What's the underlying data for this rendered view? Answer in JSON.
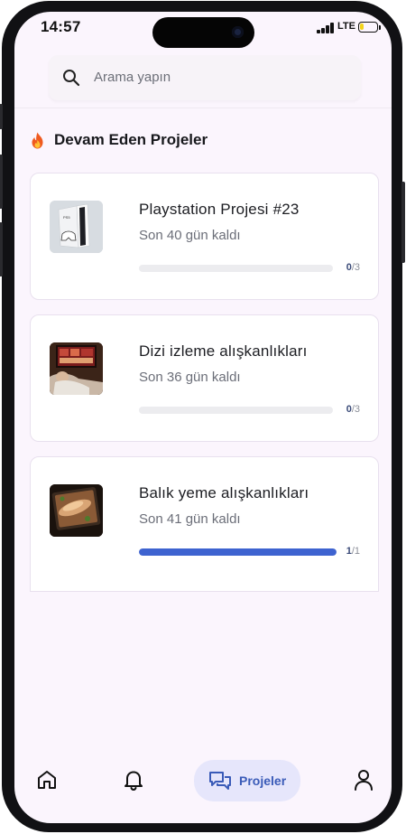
{
  "status_bar": {
    "time": "14:57",
    "network": "LTE",
    "battery_level": 0.25,
    "battery_color": "#f2d31a"
  },
  "search": {
    "placeholder": "Arama yapın"
  },
  "section": {
    "title": "Devam Eden Projeler",
    "icon": "fire-icon"
  },
  "projects": [
    {
      "title": "Playstation Projesi #23",
      "subtitle": "Son 40 gün kaldı",
      "done": "0",
      "total": "/3",
      "progress": 0.0,
      "thumbnail": "playstation-console"
    },
    {
      "title": "Dizi izleme alışkanlıkları",
      "subtitle": "Son 36 gün kaldı",
      "done": "0",
      "total": "/3",
      "progress": 0.0,
      "thumbnail": "tv-watching"
    },
    {
      "title": "Balık yeme alışkanlıkları",
      "subtitle": "Son 41 gün kaldı",
      "done": "1",
      "total": "/1",
      "progress": 1.0,
      "thumbnail": "fish-dish"
    }
  ],
  "nav": {
    "home_icon": "home-icon",
    "notifications_icon": "bell-icon",
    "projects_label": "Projeler",
    "profile_icon": "user-icon",
    "accent": "#3a5bb8"
  },
  "colors": {
    "progress_fill": "#3e63d0",
    "progress_track": "#ececef",
    "background": "#fbf5fd"
  }
}
